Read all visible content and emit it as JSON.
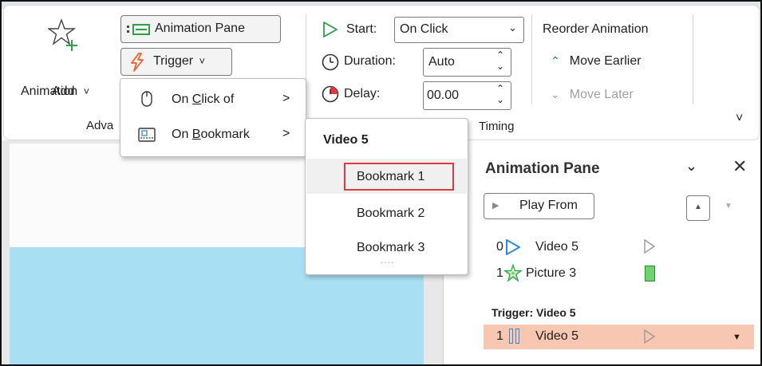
{
  "ribbon": {
    "add_animation": {
      "line1": "Add",
      "line2": "Animation",
      "chevron": "˅",
      "icon": "star-add-icon"
    },
    "animation_pane_button": {
      "label": "Animation Pane",
      "icon": "animation-pane-icon"
    },
    "trigger_button": {
      "label": "Trigger",
      "chevron": "˅",
      "icon": "lightning-icon"
    },
    "group_advanced_label": "Adva",
    "timing": {
      "start_label": "Start:",
      "start_value": "On Click",
      "duration_label": "Duration:",
      "duration_value": "Auto",
      "delay_label": "Delay:",
      "delay_value": "00.00",
      "group_label": "Timing"
    },
    "reorder": {
      "title": "Reorder Animation",
      "move_earlier": "Move Earlier",
      "move_later": "Move Later"
    },
    "expand_chevron": "˅"
  },
  "trigger_menu": {
    "items": [
      {
        "prefix": "On ",
        "key": "C",
        "rest": "lick of",
        "arrow": ">",
        "icon": "mouse-icon"
      },
      {
        "prefix": "On ",
        "key": "B",
        "rest": "ookmark",
        "arrow": ">",
        "icon": "bookmark-icon"
      }
    ]
  },
  "bookmark_menu": {
    "header": "Video 5",
    "items": [
      "Bookmark 1",
      "Bookmark 2",
      "Bookmark 3"
    ],
    "more": "....",
    "highlight_color": "#e0393e"
  },
  "animation_pane": {
    "title": "Animation Pane",
    "play_from": "Play From",
    "items": [
      {
        "index": "0",
        "name": "Video 5",
        "icon": "play-icon"
      },
      {
        "index": "1",
        "name": "Picture 3",
        "icon": "star-burst-icon"
      }
    ],
    "trigger_label": "Trigger: Video 5",
    "trigger_item": {
      "index": "1",
      "name": "Video 5",
      "icon": "pause-bars-icon"
    },
    "colors": {
      "accent": "#2a8bd8",
      "green": "#6fd36f",
      "selected_row": "#f7c7b1"
    }
  }
}
